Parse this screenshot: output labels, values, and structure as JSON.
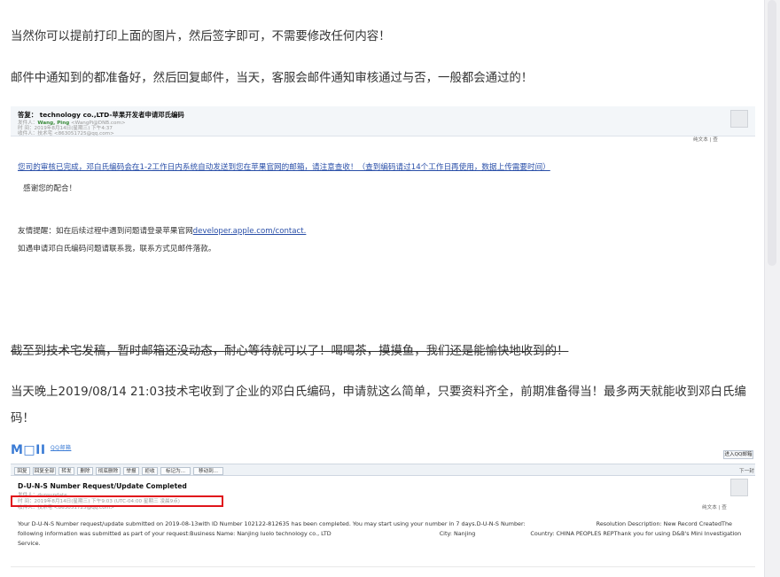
{
  "article": {
    "p1": "当然你可以提前打印上面的图片，然后签字即可，不需要修改任何内容！",
    "p2": "邮件中通知到的都准备好，然后回复邮件，当天，客服会邮件通知审核通过与否，一般都会通过的！",
    "p3": "截至到技术宅发稿，暂时邮箱还没动态，耐心等待就可以了！喝喝茶，摸摸鱼，我们还是能愉快地收到的！",
    "p4": "当天晚上2019/08/14  21:03技术宅收到了企业的邓白氏编码，申请就这么简单，只要资料齐全，前期准备得当！最多两天就能收到邓白氏编码！"
  },
  "mail1": {
    "subject": "答复：                  technology co.,LTD-苹果开发者申请邓氏编码",
    "from_label": "发件人：",
    "from_name": "Wang, Ping",
    "from_addr": "<WangPi@DNB.com>",
    "time": "时  间：2019年8月14日(星期三) 下午4:37",
    "to": "收件人：技术宅 <863051725@qq.com>",
    "plain_text": "纯文本 | 查",
    "line1": "您司的审核已完成，邓白氏编码会在1-2工作日内系统自动发送到您在苹果官网的邮箱，请注意查收！（查到编码请过14个工作日再使用，数据上传需要时间）",
    "line2": "感谢您的配合！",
    "line3_prefix": "友情提醒：如在后续过程中遇到问题请登录苹果官网",
    "line3_link": "developer.apple.com/contact.",
    "line4": "如遇申请邓白氏编码问题请联系我，联系方式见邮件落款。"
  },
  "mail2": {
    "logo": "M□II",
    "logo_small": "QQ邮箱",
    "top_right": "进入QQ邮箱",
    "toolbar": [
      "回复",
      "回复全部",
      "转发",
      "删除",
      "彻底删除",
      "举报",
      "拒收",
      "标记为...",
      "移动到..."
    ],
    "next": "下一封",
    "subject": "D-U-N-S Number Request/Update Completed",
    "from": "发件人：dunsupdate",
    "time": "时  间：2019年8月14日(星期三) 下午9:03 (UTC-04:00 星期三 凌晨9点)",
    "to": "收件人：技术宅 <863051725@qq.com>",
    "plain_text": "纯文本 | 查",
    "body_a": "Your D-U-N-S Number request/update submitted on 2019-08-13with ID Number 102122-812635 has been completed.  You may start using your number in 7 days.D-U-N-S Number:",
    "body_b": "Resolution Description: New Record CreatedThe following information was submitted as part of your request:Business Name: Nanjing luolo technology co., LTD",
    "body_city": "City: Nanjing",
    "body_country": "Country: CHINA PEOPLES REPThank you for using D&B's Mini Investigation Service.",
    "highlight_color": "#e0151b"
  }
}
